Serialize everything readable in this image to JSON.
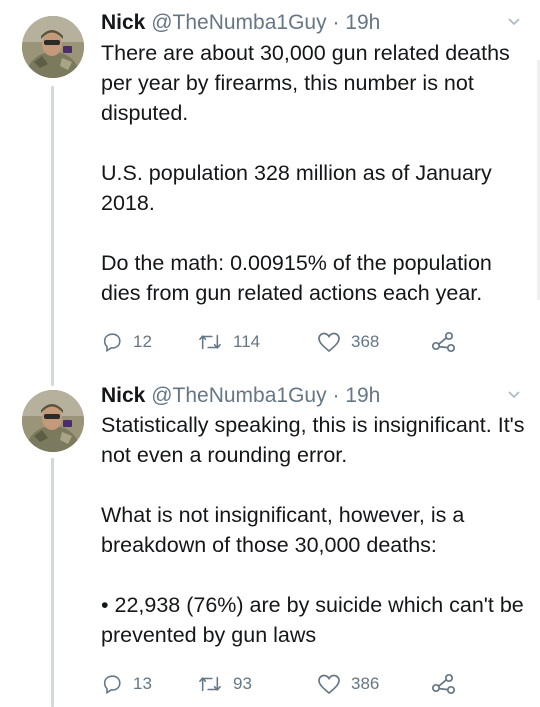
{
  "tweets": [
    {
      "display_name": "Nick",
      "handle": "@TheNumba1Guy",
      "separator": "·",
      "time": "19h",
      "paragraphs": [
        "There are about 30,000 gun related deaths per year by firearms, this number is not disputed.",
        "U.S. population 328 million as of January 2018.",
        "Do the math: 0.00915% of the population dies from gun related actions each year."
      ],
      "reply_count": "12",
      "retweet_count": "114",
      "like_count": "368"
    },
    {
      "display_name": "Nick",
      "handle": "@TheNumba1Guy",
      "separator": "·",
      "time": "19h",
      "paragraphs": [
        "Statistically speaking, this is insignificant. It's not even a rounding error.",
        "What is not insignificant, however, is a breakdown of those 30,000 deaths:",
        "• 22,938 (76%) are by suicide which can't be prevented by gun laws"
      ],
      "reply_count": "13",
      "retweet_count": "93",
      "like_count": "386"
    }
  ],
  "icons": {
    "reply": "reply-icon",
    "retweet": "retweet-icon",
    "like": "heart-icon",
    "share": "share-icon",
    "caret": "chevron-down-icon"
  },
  "colors": {
    "text": "#14171a",
    "secondary": "#657786",
    "thread_line": "#cfd9de"
  }
}
